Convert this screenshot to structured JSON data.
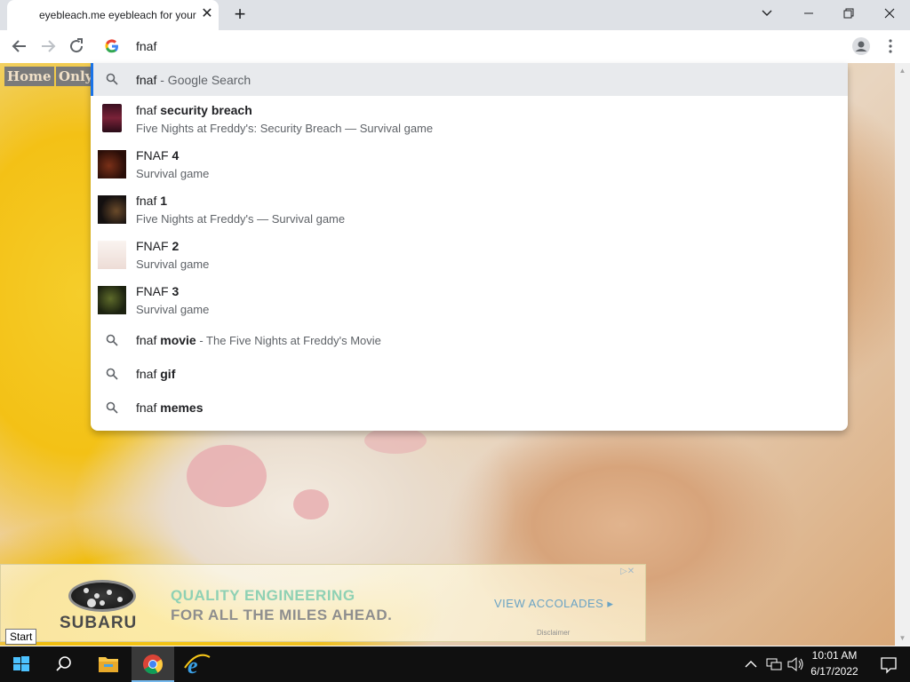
{
  "window": {
    "tab_title": "eyebleach.me eyebleach for your",
    "tab_close": "✕",
    "new_tab": "+"
  },
  "omnibox": {
    "query": "fnaf"
  },
  "suggestions": [
    {
      "bold_part": "",
      "normal_part": "fnaf",
      "suffix": " - Google Search",
      "type": "search",
      "selected": true
    },
    {
      "normal_part": "fnaf ",
      "bold_part": "security breach",
      "subtitle": "Five Nights at Freddy's: Security Breach — Survival game",
      "type": "entity"
    },
    {
      "normal_part": "FNAF ",
      "bold_part": "4",
      "subtitle": "Survival game",
      "type": "entity"
    },
    {
      "normal_part": "fnaf ",
      "bold_part": "1",
      "subtitle": "Five Nights at Freddy's — Survival game",
      "type": "entity"
    },
    {
      "normal_part": "FNAF ",
      "bold_part": "2",
      "subtitle": "Survival game",
      "type": "entity"
    },
    {
      "normal_part": "FNAF ",
      "bold_part": "3",
      "subtitle": "Survival game",
      "type": "entity"
    },
    {
      "normal_part": "fnaf ",
      "bold_part": "movie",
      "suffix": " - The Five Nights at Freddy's Movie",
      "type": "search"
    },
    {
      "normal_part": "fnaf ",
      "bold_part": "gif",
      "type": "search"
    },
    {
      "normal_part": "fnaf ",
      "bold_part": "memes",
      "type": "search"
    }
  ],
  "page": {
    "nav_home": "Home",
    "nav_only": "Only"
  },
  "ad": {
    "brand": "SUBARU",
    "line1": "QUALITY ENGINEERING",
    "line2": "FOR ALL THE MILES AHEAD.",
    "cta": "VIEW ACCOLADES ▸",
    "disclaimer": "Disclaimer"
  },
  "tooltip": {
    "start": "Start"
  },
  "taskbar": {
    "time": "10:01 AM",
    "date": "6/17/2022"
  },
  "colors": {
    "accent": "#1a73e8",
    "taskbar": "#101010",
    "tab_strip": "#dee1e6"
  }
}
